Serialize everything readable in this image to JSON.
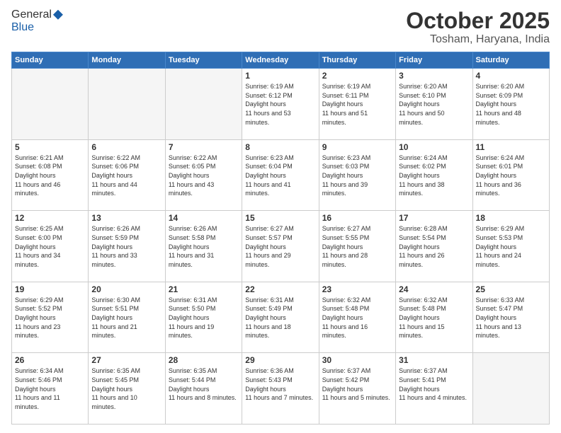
{
  "header": {
    "logo_general": "General",
    "logo_blue": "Blue",
    "month_title": "October 2025",
    "location": "Tosham, Haryana, India"
  },
  "days_of_week": [
    "Sunday",
    "Monday",
    "Tuesday",
    "Wednesday",
    "Thursday",
    "Friday",
    "Saturday"
  ],
  "weeks": [
    [
      {
        "day": "",
        "empty": true
      },
      {
        "day": "",
        "empty": true
      },
      {
        "day": "",
        "empty": true
      },
      {
        "day": "1",
        "sunrise": "6:19 AM",
        "sunset": "6:12 PM",
        "daylight": "11 hours and 53 minutes."
      },
      {
        "day": "2",
        "sunrise": "6:19 AM",
        "sunset": "6:11 PM",
        "daylight": "11 hours and 51 minutes."
      },
      {
        "day": "3",
        "sunrise": "6:20 AM",
        "sunset": "6:10 PM",
        "daylight": "11 hours and 50 minutes."
      },
      {
        "day": "4",
        "sunrise": "6:20 AM",
        "sunset": "6:09 PM",
        "daylight": "11 hours and 48 minutes."
      }
    ],
    [
      {
        "day": "5",
        "sunrise": "6:21 AM",
        "sunset": "6:08 PM",
        "daylight": "11 hours and 46 minutes."
      },
      {
        "day": "6",
        "sunrise": "6:22 AM",
        "sunset": "6:06 PM",
        "daylight": "11 hours and 44 minutes."
      },
      {
        "day": "7",
        "sunrise": "6:22 AM",
        "sunset": "6:05 PM",
        "daylight": "11 hours and 43 minutes."
      },
      {
        "day": "8",
        "sunrise": "6:23 AM",
        "sunset": "6:04 PM",
        "daylight": "11 hours and 41 minutes."
      },
      {
        "day": "9",
        "sunrise": "6:23 AM",
        "sunset": "6:03 PM",
        "daylight": "11 hours and 39 minutes."
      },
      {
        "day": "10",
        "sunrise": "6:24 AM",
        "sunset": "6:02 PM",
        "daylight": "11 hours and 38 minutes."
      },
      {
        "day": "11",
        "sunrise": "6:24 AM",
        "sunset": "6:01 PM",
        "daylight": "11 hours and 36 minutes."
      }
    ],
    [
      {
        "day": "12",
        "sunrise": "6:25 AM",
        "sunset": "6:00 PM",
        "daylight": "11 hours and 34 minutes."
      },
      {
        "day": "13",
        "sunrise": "6:26 AM",
        "sunset": "5:59 PM",
        "daylight": "11 hours and 33 minutes."
      },
      {
        "day": "14",
        "sunrise": "6:26 AM",
        "sunset": "5:58 PM",
        "daylight": "11 hours and 31 minutes."
      },
      {
        "day": "15",
        "sunrise": "6:27 AM",
        "sunset": "5:57 PM",
        "daylight": "11 hours and 29 minutes."
      },
      {
        "day": "16",
        "sunrise": "6:27 AM",
        "sunset": "5:55 PM",
        "daylight": "11 hours and 28 minutes."
      },
      {
        "day": "17",
        "sunrise": "6:28 AM",
        "sunset": "5:54 PM",
        "daylight": "11 hours and 26 minutes."
      },
      {
        "day": "18",
        "sunrise": "6:29 AM",
        "sunset": "5:53 PM",
        "daylight": "11 hours and 24 minutes."
      }
    ],
    [
      {
        "day": "19",
        "sunrise": "6:29 AM",
        "sunset": "5:52 PM",
        "daylight": "11 hours and 23 minutes."
      },
      {
        "day": "20",
        "sunrise": "6:30 AM",
        "sunset": "5:51 PM",
        "daylight": "11 hours and 21 minutes."
      },
      {
        "day": "21",
        "sunrise": "6:31 AM",
        "sunset": "5:50 PM",
        "daylight": "11 hours and 19 minutes."
      },
      {
        "day": "22",
        "sunrise": "6:31 AM",
        "sunset": "5:49 PM",
        "daylight": "11 hours and 18 minutes."
      },
      {
        "day": "23",
        "sunrise": "6:32 AM",
        "sunset": "5:48 PM",
        "daylight": "11 hours and 16 minutes."
      },
      {
        "day": "24",
        "sunrise": "6:32 AM",
        "sunset": "5:48 PM",
        "daylight": "11 hours and 15 minutes."
      },
      {
        "day": "25",
        "sunrise": "6:33 AM",
        "sunset": "5:47 PM",
        "daylight": "11 hours and 13 minutes."
      }
    ],
    [
      {
        "day": "26",
        "sunrise": "6:34 AM",
        "sunset": "5:46 PM",
        "daylight": "11 hours and 11 minutes."
      },
      {
        "day": "27",
        "sunrise": "6:35 AM",
        "sunset": "5:45 PM",
        "daylight": "11 hours and 10 minutes."
      },
      {
        "day": "28",
        "sunrise": "6:35 AM",
        "sunset": "5:44 PM",
        "daylight": "11 hours and 8 minutes."
      },
      {
        "day": "29",
        "sunrise": "6:36 AM",
        "sunset": "5:43 PM",
        "daylight": "11 hours and 7 minutes."
      },
      {
        "day": "30",
        "sunrise": "6:37 AM",
        "sunset": "5:42 PM",
        "daylight": "11 hours and 5 minutes."
      },
      {
        "day": "31",
        "sunrise": "6:37 AM",
        "sunset": "5:41 PM",
        "daylight": "11 hours and 4 minutes."
      },
      {
        "day": "",
        "empty": true
      }
    ]
  ]
}
